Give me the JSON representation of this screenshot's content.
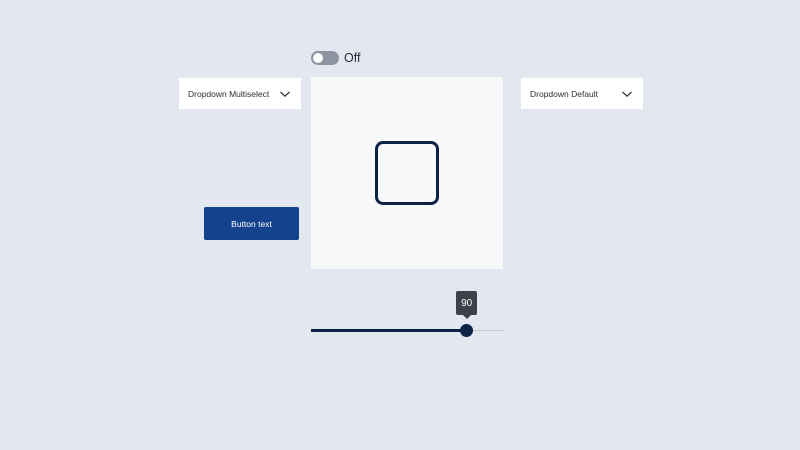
{
  "toggle": {
    "label": "Off",
    "state": false
  },
  "dropdowns": {
    "multiselect": {
      "label": "Dropdown Multiselect",
      "icon": "chevron-down-icon"
    },
    "default": {
      "label": "Dropdown Default",
      "icon": "chevron-down-icon"
    }
  },
  "button": {
    "label": "Button text"
  },
  "slider": {
    "value": 90,
    "tooltip": "90",
    "fraction": 0.8
  },
  "colors": {
    "background": "#e3e7ef",
    "accent": "#15428c",
    "dark": "#0c2347",
    "toggle_off": "#8d93a0"
  }
}
